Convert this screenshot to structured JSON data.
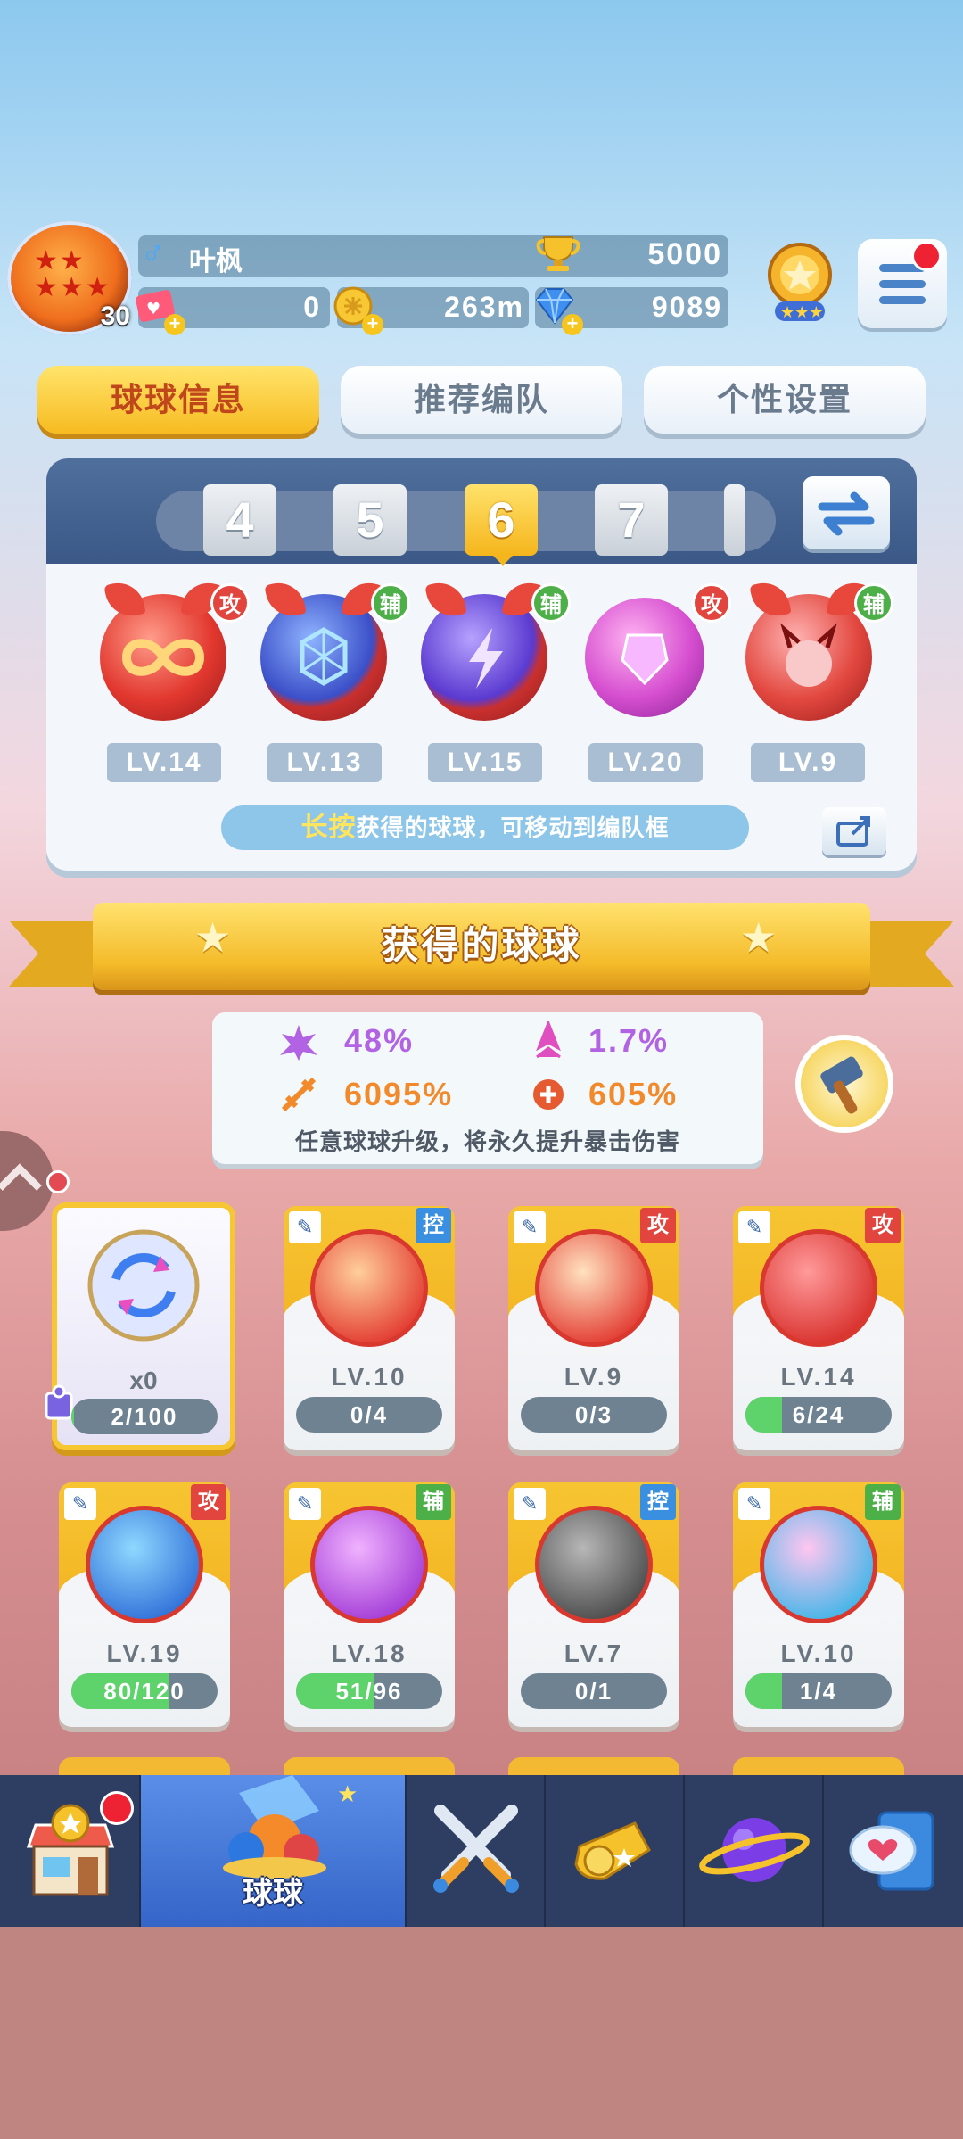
{
  "player": {
    "name": "叶枫",
    "level": "30",
    "gender_symbol": "♂",
    "trophies": "5000"
  },
  "resources": {
    "tickets": "0",
    "coins": "263m",
    "gems": "9089"
  },
  "tabs": [
    {
      "label": "球球信息",
      "active": true
    },
    {
      "label": "推荐编队",
      "active": false
    },
    {
      "label": "个性设置",
      "active": false
    }
  ],
  "team": {
    "numbers": [
      "4",
      "5",
      "6",
      "7"
    ],
    "selected": "6",
    "slots": [
      {
        "role": "攻",
        "level": "LV.14",
        "icon": "infinity-orb-icon"
      },
      {
        "role": "辅",
        "level": "LV.13",
        "icon": "hex-shield-orb-icon"
      },
      {
        "role": "辅",
        "level": "LV.15",
        "icon": "lightning-orb-icon"
      },
      {
        "role": "攻",
        "level": "LV.20",
        "icon": "purple-crystal-orb-icon"
      },
      {
        "role": "辅",
        "level": "LV.9",
        "icon": "demon-orb-icon"
      }
    ],
    "hint_highlight": "长按",
    "hint_text": "获得的球球，可移动到编队框"
  },
  "section_title": "获得的球球",
  "crit": {
    "rate_a": "48%",
    "rate_b": "1.7%",
    "dmg_a": "6095%",
    "dmg_b": "605%",
    "note": "任意球球升级，将永久提升暴击伤害"
  },
  "special_card": {
    "count": "x0",
    "progress": "2/100"
  },
  "cards": [
    {
      "role": "控",
      "level": "LV.10",
      "progress": "0/4",
      "fill": 0.0
    },
    {
      "role": "攻",
      "level": "LV.9",
      "progress": "0/3",
      "fill": 0.0
    },
    {
      "role": "攻",
      "level": "LV.14",
      "progress": "6/24",
      "fill": 0.25
    },
    {
      "role": "攻",
      "level": "LV.19",
      "progress": "80/120",
      "fill": 0.667
    },
    {
      "role": "辅",
      "level": "LV.18",
      "progress": "51/96",
      "fill": 0.531
    },
    {
      "role": "控",
      "level": "LV.7",
      "progress": "0/1",
      "fill": 0.0
    },
    {
      "role": "辅",
      "level": "LV.10",
      "progress": "1/4",
      "fill": 0.25
    }
  ],
  "nav": [
    {
      "label": "",
      "icon": "shop-icon"
    },
    {
      "label": "球球",
      "icon": "ball-bucket-icon",
      "active": true
    },
    {
      "label": "",
      "icon": "crossed-swords-icon"
    },
    {
      "label": "",
      "icon": "whistle-icon"
    },
    {
      "label": "",
      "icon": "planet-icon"
    },
    {
      "label": "",
      "icon": "chat-heart-icon"
    }
  ],
  "colors": {
    "accent_gold": "#f4b52a",
    "attack": "#e2453d",
    "support": "#4caf48",
    "control": "#3a8fe0",
    "nav_bg": "#2d3e62"
  }
}
